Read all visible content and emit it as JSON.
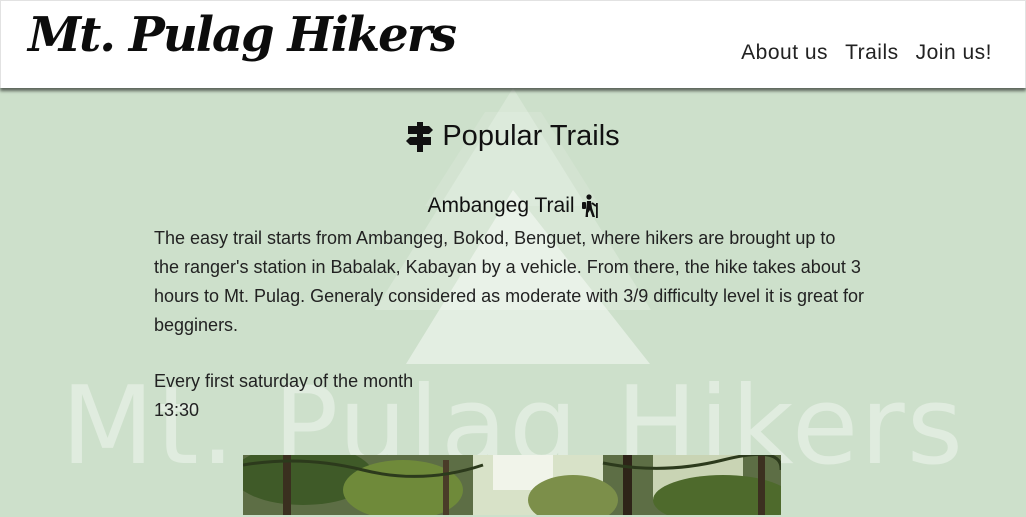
{
  "header": {
    "logo": "Mt. Pulag Hikers",
    "nav": [
      "About us",
      "Trails",
      "Join us!"
    ]
  },
  "background": {
    "watermark_text": "Mt. Pulag Hikers"
  },
  "main": {
    "section_title": "Popular Trails",
    "section_icon": "signpost-icon",
    "trail": {
      "name": "Ambangeg Trail",
      "icon": "hiking-icon",
      "description": "The easy trail starts from Ambangeg, Bokod, Benguet, where hikers are brought up to the ranger's station in Babalak, Kabayan by a vehicle. From there, the hike takes about 3 hours to Mt. Pulag. Generaly considered as moderate with 3/9 difficulty level it is great for begginers.",
      "schedule_day": "Every first saturday of the month",
      "schedule_time": "13:30"
    }
  },
  "colors": {
    "background": "#cde0cb",
    "header": "#ffffff",
    "text": "#1c1c1c"
  }
}
